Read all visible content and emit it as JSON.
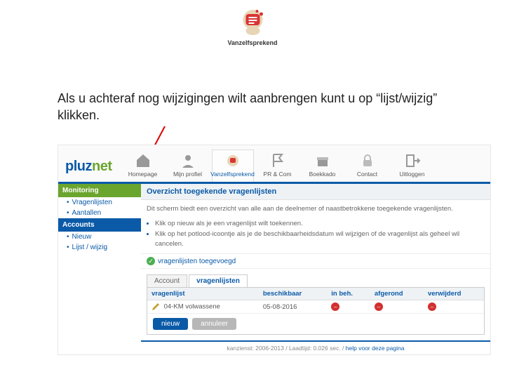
{
  "header": {
    "logo_caption": "Vanzelfsprekend"
  },
  "instruction": "Als u achteraf nog wijzigingen wilt aanbrengen kunt u op “lijst/wijzig” klikken.",
  "brand": {
    "part1": "pluz",
    "part2": "net"
  },
  "nav": {
    "items": [
      {
        "label": "Homepage"
      },
      {
        "label": "Mijn profiel"
      },
      {
        "label": "Vanzelfsprekend"
      },
      {
        "label": "PR & Com"
      },
      {
        "label": "Boekkado"
      },
      {
        "label": "Contact"
      },
      {
        "label": "Uitloggen"
      }
    ]
  },
  "sidebar": {
    "monitoring_head": "Monitoring",
    "monitoring_items": [
      {
        "label": "Vragenlijsten"
      },
      {
        "label": "Aantallen"
      }
    ],
    "accounts_head": "Accounts",
    "accounts_items": [
      {
        "label": "Nieuw"
      },
      {
        "label": "Lijst / wijzig"
      }
    ]
  },
  "main": {
    "title": "Overzicht toegekende vragenlijsten",
    "intro": "Dit scherm biedt een overzicht van alle aan de deelnemer of naastbetrokkene toegekende vragenlijsten.",
    "bullets": [
      "Klik op nieuw als je een vragenlijst wilt toekennen.",
      "Klik op het potlood-icoontje als je de beschikbaarheidsdatum wil wijzigen of de vragenlijst als geheel wil cancelen."
    ],
    "success": "vragenlijsten toegevoegd",
    "tabs": [
      {
        "label": "Account"
      },
      {
        "label": "vragenlijsten"
      }
    ],
    "table": {
      "headers": [
        "vragenlijst",
        "beschikbaar",
        "in beh.",
        "afgerond",
        "verwijderd"
      ],
      "rows": [
        {
          "name": "04-KM volwassene",
          "beschikbaar": "05-08-2016"
        }
      ]
    },
    "buttons": {
      "new": "nieuw",
      "cancel": "annuleer"
    },
    "footer": {
      "copyright": "kanzienst: 2006-2013 /",
      "loadtime_label": "Laadtijd:",
      "loadtime_value": "0.026 sec. /",
      "help": "help voor deze pagina"
    }
  }
}
